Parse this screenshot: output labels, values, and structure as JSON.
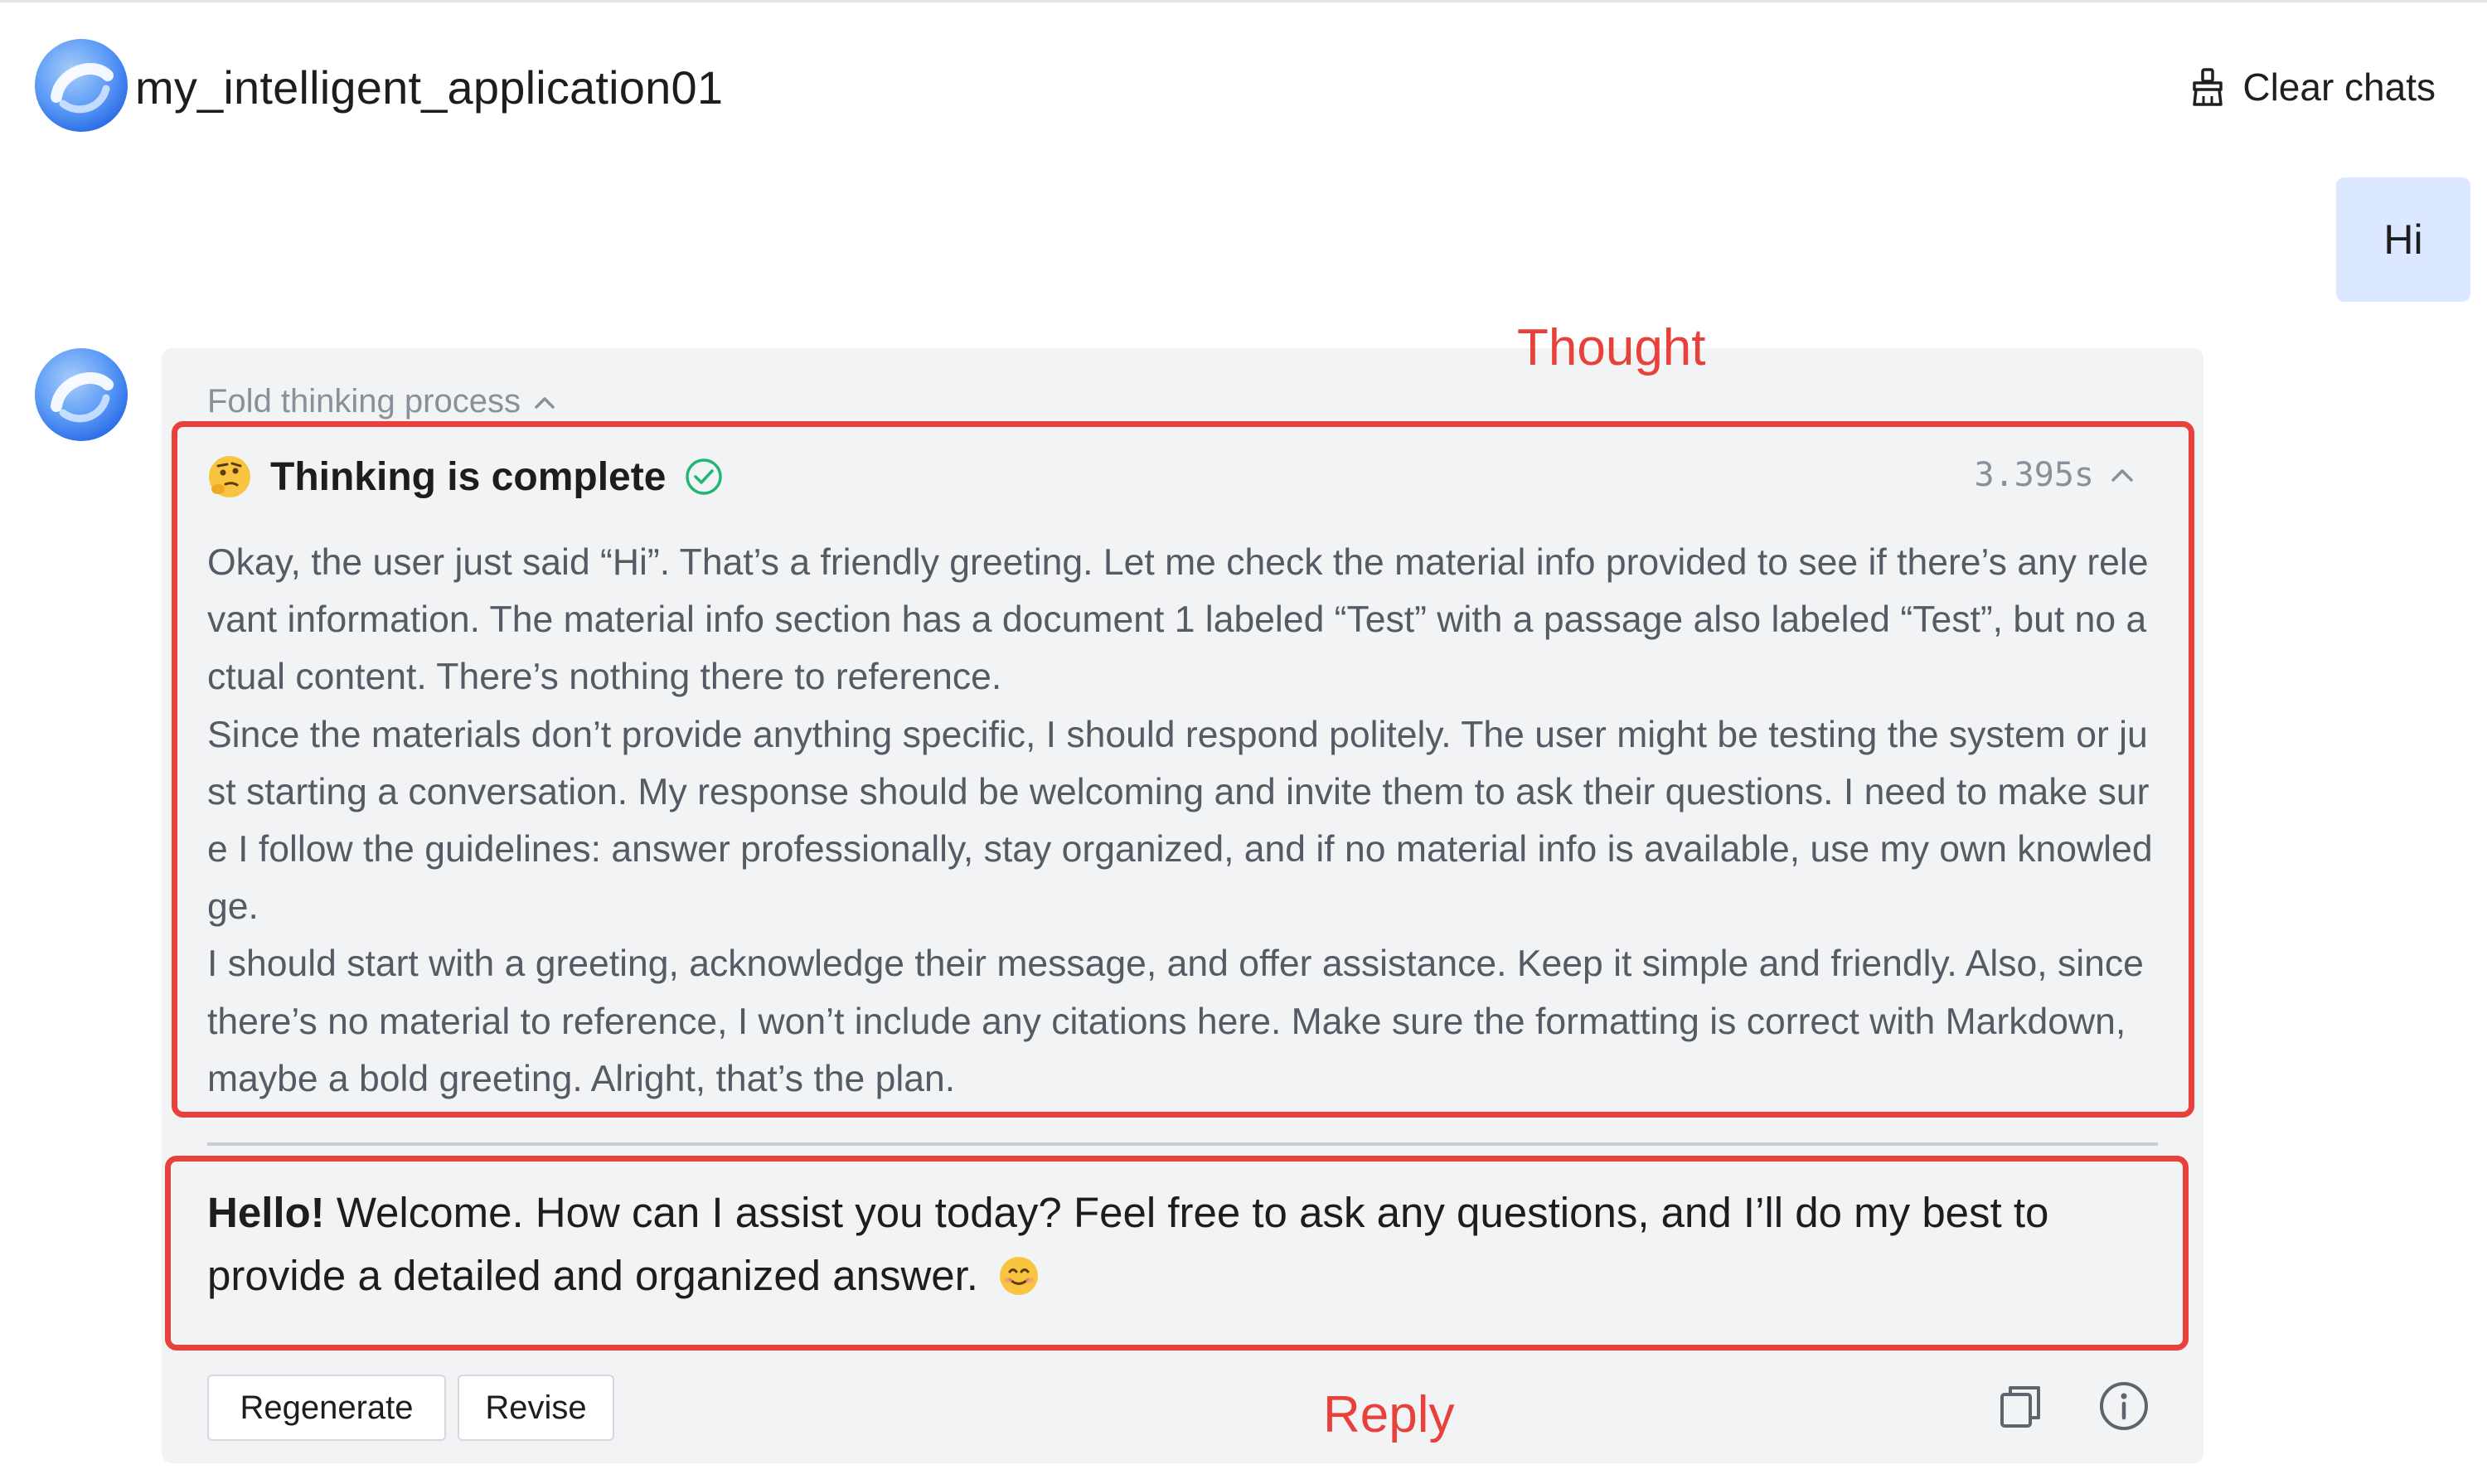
{
  "header": {
    "app_name": "my_intelligent_application01",
    "clear_chats_label": "Clear chats",
    "clear_icon": "broom-icon"
  },
  "user_message": {
    "text": "Hi"
  },
  "thinking": {
    "fold_label": "Fold thinking process",
    "emoji": "thinking-face-emoji",
    "status": "Thinking is complete",
    "elapsed": "3.395s",
    "paragraphs": [
      "Okay, the user just said “Hi”. That’s a friendly greeting. Let me check the material info provided to see if there’s any relevant information. The material info section has a document 1 labeled “Test” with a passage also labeled “Test”, but no actual content. There’s nothing there to reference.",
      "Since the materials don’t provide anything specific, I should respond politely. The user might be testing the system or just starting a conversation. My response should be welcoming and invite them to ask their questions. I need to make sure I follow the guidelines: answer professionally, stay organized, and if no material info is available, use my own knowledge.",
      "I should start with a greeting, acknowledge their message, and offer assistance. Keep it simple and friendly. Also, since there’s no material to reference, I won’t include any citations here. Make sure the formatting is correct with Markdown, maybe a bold greeting. Alright, that’s the plan."
    ]
  },
  "answer": {
    "bold_greeting": "Hello!",
    "text": " Welcome. How can I assist you today? Feel free to ask any questions, and I’ll do my best to provide a detailed and organized answer.",
    "emoji": "smiling-face-emoji"
  },
  "actions": {
    "regenerate_label": "Regenerate",
    "revise_label": "Revise",
    "copy_icon": "copy-icon",
    "info_icon": "info-icon"
  },
  "annotations": {
    "thought_label": "Thought",
    "reply_label": "Reply",
    "color": "#e8413b"
  },
  "colors": {
    "user_bubble": "#dbe8ff",
    "card_background": "#f2f3f5",
    "success_green": "#22b573"
  }
}
